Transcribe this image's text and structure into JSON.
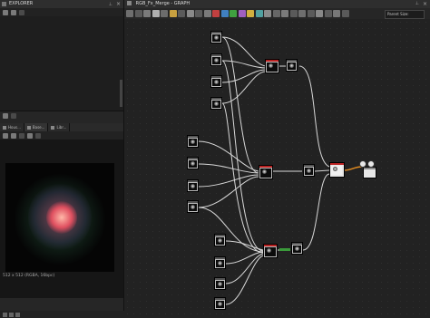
{
  "explorer": {
    "title": "EXPLORER"
  },
  "viewer": {
    "tabs": [
      {
        "label": "Hous..."
      },
      {
        "label": "Base..."
      },
      {
        "label": "Libr..."
      }
    ],
    "resolution_text": "512 x 512 (RGBA, 16bpc)"
  },
  "graph": {
    "title": "RGB_Fx_Merge - GRAPH",
    "parent_size": "Parent Size:"
  },
  "colors": {
    "accent_red": "#b22222",
    "link": "#d8d8d8",
    "orange_link": "#e08a20"
  },
  "icons": [
    "pin-icon",
    "close-icon",
    "save-icon",
    "folder-icon",
    "search-icon"
  ]
}
